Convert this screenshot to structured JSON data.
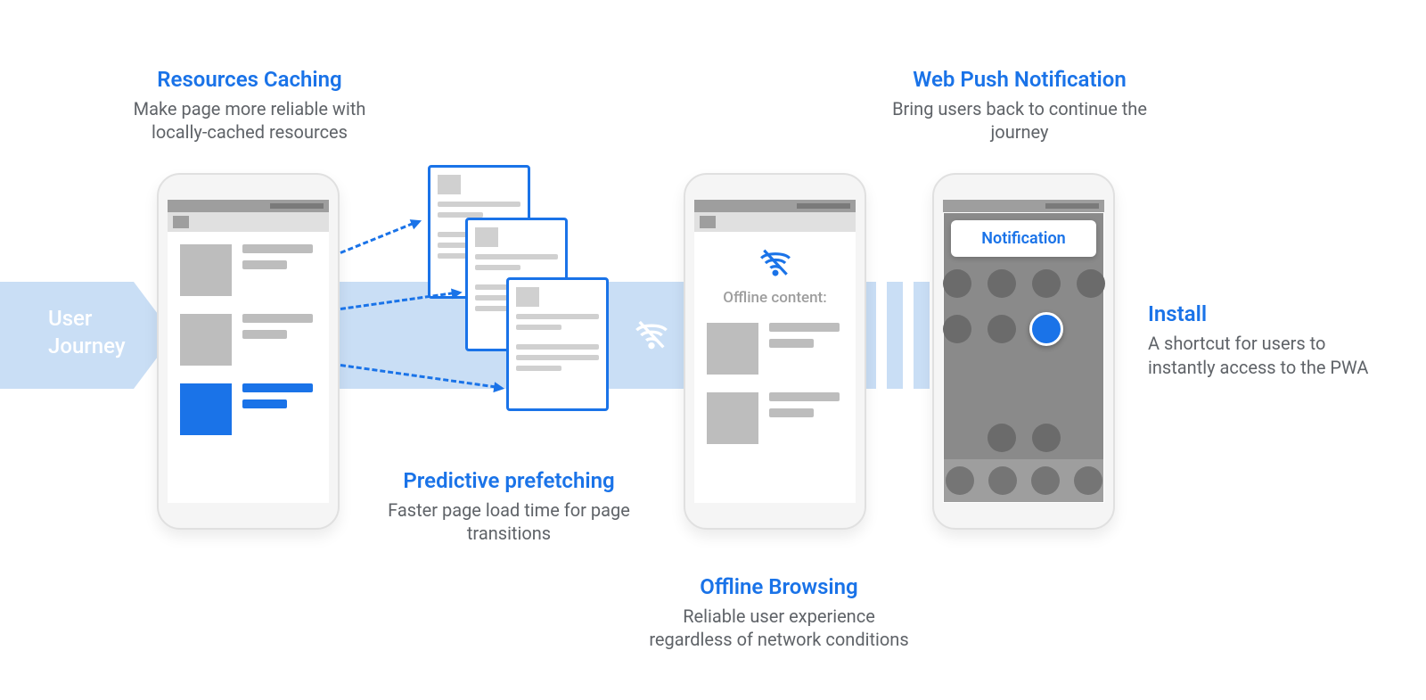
{
  "journey_label_line1": "User",
  "journey_label_line2": "Journey",
  "caching": {
    "title": "Resources Caching",
    "sub": "Make page more reliable with locally-cached resources"
  },
  "prefetch": {
    "title": "Predictive prefetching",
    "sub": "Faster page load time for page transitions"
  },
  "offline": {
    "title": "Offline Browsing",
    "sub": "Reliable user experience regardless of network conditions",
    "content_label": "Offline content:"
  },
  "push": {
    "title": "Web Push Notification",
    "sub": "Bring users back to continue the journey",
    "notif_text": "Notification"
  },
  "install": {
    "title": "Install",
    "sub": "A shortcut for users to instantly access to the PWA"
  }
}
